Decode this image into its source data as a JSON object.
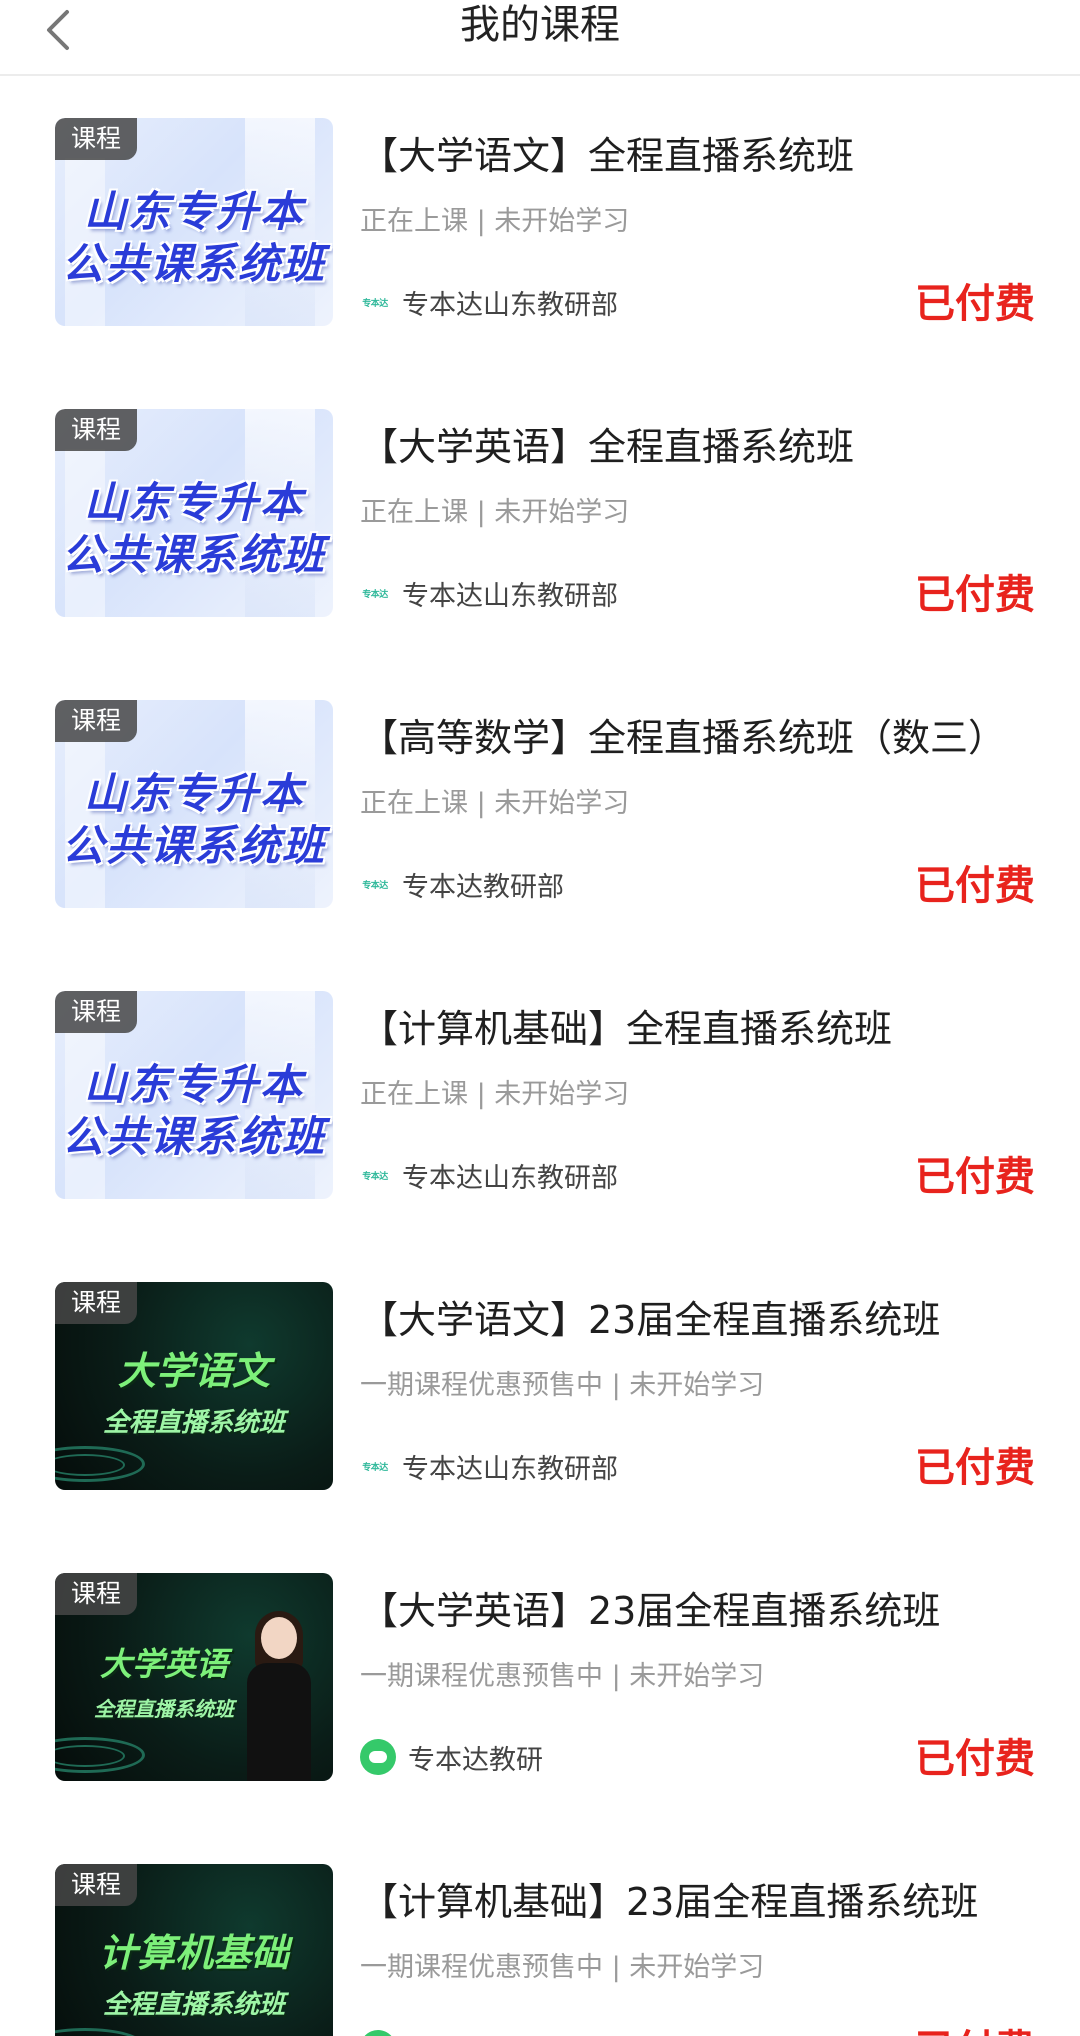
{
  "header": {
    "title": "我的课程"
  },
  "courses": [
    {
      "tag": "课程",
      "thumb_style": "light",
      "thumb_line1": "山东专升本",
      "thumb_line2": "公共课系统班",
      "title": "【大学语文】全程直播系统班",
      "status": "正在上课 | 未开始学习",
      "org": "专本达山东教研部",
      "org_logo": "small-text-logo",
      "paid": "已付费"
    },
    {
      "tag": "课程",
      "thumb_style": "light",
      "thumb_line1": "山东专升本",
      "thumb_line2": "公共课系统班",
      "title": "【大学英语】全程直播系统班",
      "status": "正在上课 | 未开始学习",
      "org": "专本达山东教研部",
      "org_logo": "small-text-logo",
      "paid": "已付费"
    },
    {
      "tag": "课程",
      "thumb_style": "light",
      "thumb_line1": "山东专升本",
      "thumb_line2": "公共课系统班",
      "title": "【高等数学】全程直播系统班（数三）",
      "status": "正在上课 | 未开始学习",
      "org": "专本达教研部",
      "org_logo": "small-text-logo",
      "paid": "已付费"
    },
    {
      "tag": "课程",
      "thumb_style": "light",
      "thumb_line1": "山东专升本",
      "thumb_line2": "公共课系统班",
      "title": "【计算机基础】全程直播系统班",
      "status": "正在上课 | 未开始学习",
      "org": "专本达山东教研部",
      "org_logo": "small-text-logo",
      "paid": "已付费"
    },
    {
      "tag": "课程",
      "thumb_style": "dark",
      "thumb_line1": "大学语文",
      "thumb_line2": "全程直播系统班",
      "title": "【大学语文】23届全程直播系统班",
      "status": "一期课程优惠预售中 | 未开始学习",
      "org": "专本达山东教研部",
      "org_logo": "small-text-logo",
      "paid": "已付费"
    },
    {
      "tag": "课程",
      "thumb_style": "dark-person",
      "thumb_line1": "大学英语",
      "thumb_line2": "全程直播系统班",
      "title": "【大学英语】23届全程直播系统班",
      "status": "一期课程优惠预售中 | 未开始学习",
      "org": "专本达教研",
      "org_logo": "round-green-logo",
      "paid": "已付费"
    },
    {
      "tag": "课程",
      "thumb_style": "dark",
      "thumb_line1": "计算机基础",
      "thumb_line2": "全程直播系统班",
      "title": "【计算机基础】23届全程直播系统班",
      "status": "一期课程优惠预售中 | 未开始学习",
      "org": "",
      "org_logo": "round-green-logo",
      "paid": "已付费"
    }
  ],
  "logo_mini_text": "专本达",
  "colors": {
    "paid": "#e8231d",
    "title": "#1f1f1f",
    "status": "#9a9a9a",
    "accent_green": "#35c96a"
  },
  "icons": {
    "back": "chevron-left-icon"
  }
}
